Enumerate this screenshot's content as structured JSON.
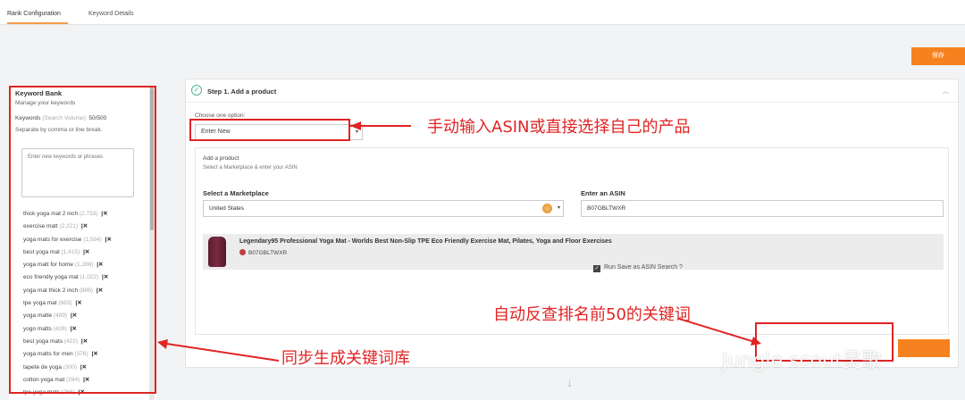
{
  "tabs": [
    {
      "label": "Rank Configuration",
      "active": true
    },
    {
      "label": "Keyword Details",
      "active": false
    }
  ],
  "save_button": "保存",
  "keyword_bank": {
    "title": "Keyword Bank",
    "subtitle": "Manage your keywords",
    "count_label": "Keywords",
    "count_hint": "(Search Volume):",
    "count_value": "50/500",
    "separator_hint": "Separate by comma or line break.",
    "textarea_placeholder": "Enter new keywords or phrases",
    "items": [
      {
        "keyword": "thick yoga mat 2 inch",
        "volume": "(2,733)"
      },
      {
        "keyword": "exercise matt",
        "volume": "(2,221)"
      },
      {
        "keyword": "yoga mats for exercise",
        "volume": "(1,584)"
      },
      {
        "keyword": "best yoga mat",
        "volume": "(1,415)"
      },
      {
        "keyword": "yoga matt for home",
        "volume": "(1,286)"
      },
      {
        "keyword": "eco friendly yoga mat",
        "volume": "(1,022)"
      },
      {
        "keyword": "yoga mat thick 2 inch",
        "volume": "(886)"
      },
      {
        "keyword": "tpe yoga mat",
        "volume": "(663)"
      },
      {
        "keyword": "yoga matte",
        "volume": "(489)"
      },
      {
        "keyword": "yogo matts",
        "volume": "(428)"
      },
      {
        "keyword": "best yoga mats",
        "volume": "(422)"
      },
      {
        "keyword": "yoga matts for men",
        "volume": "(376)"
      },
      {
        "keyword": "tapete de yoga",
        "volume": "(300)"
      },
      {
        "keyword": "cotton yoga mat",
        "volume": "(294)"
      },
      {
        "keyword": "tpe yoga mats",
        "volume": "(266)"
      }
    ],
    "remove_glyph": "|✕"
  },
  "step": {
    "title": "Step 1. Add a product",
    "choose_label": "Choose one option:",
    "option_value": "Enter New",
    "add_product_title": "Add a product",
    "add_product_sub": "Select a Marketplace & enter your ASIN",
    "marketplace_label": "Select a Marketplace",
    "marketplace_value": "United States",
    "asin_label": "Enter an ASIN",
    "asin_value": "B07GBLTWXR",
    "product_title": "Legendary95 Professional Yoga Mat - Worlds Best Non-Slip TPE Eco Friendly Exercise Mat, Pilates, Yoga and Floor Exercises",
    "product_asin": "B07GBLTWXR",
    "save_asin_label": "Run Save as ASIN Search ?"
  },
  "annotations": {
    "top": "手动输入ASIN或直接选择自己的产品",
    "middle": "自动反查排名前50的关键词",
    "left": "同步生成关键词库"
  },
  "watermark": "Jungle scout吴歌",
  "colors": {
    "accent_orange": "#f5821f",
    "annotation_red": "#e02424",
    "check_green": "#4cb88a"
  }
}
